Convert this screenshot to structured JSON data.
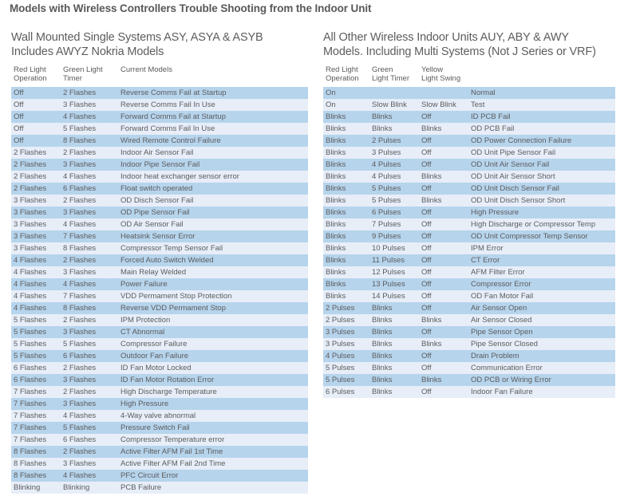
{
  "page": {
    "title": "Models with Wireless Controllers Trouble Shooting from the Indoor Unit",
    "stripe_dark": "#b6d4ec",
    "stripe_light": "#e7eef8",
    "text_color": "#5b5b5d"
  },
  "left": {
    "subtitle_line1": "Wall Mounted Single Systems ASY, ASYA & ASYB",
    "subtitle_line2": "Includes AWYZ Nokria Models",
    "headers": [
      "Red Light\nOperation",
      "Green Light\nTimer",
      "Current Models"
    ],
    "rows": [
      [
        "Off",
        "2 Flashes",
        "Reverse Comms Fail at Startup"
      ],
      [
        "Off",
        "3 Flashes",
        "Reverse Comms Fail In Use"
      ],
      [
        "Off",
        "4 Flashes",
        "Forward Comms Fail at Startup"
      ],
      [
        "Off",
        "5 Flashes",
        "Forward Comms Fail In Use"
      ],
      [
        "Off",
        "8 Flashes",
        "Wired Remote Control Failure"
      ],
      [
        "2 Flashes",
        "2 Flashes",
        "Indoor Air Sensor Fail"
      ],
      [
        "2 Flashes",
        "3 Flashes",
        "Indoor Pipe Sensor Fail"
      ],
      [
        "2 Flashes",
        "4 Flashes",
        "Indoor heat exchanger sensor error"
      ],
      [
        "2 Flashes",
        "6 Flashes",
        "Float switch operated"
      ],
      [
        "3 Flashes",
        "2 Flashes",
        "OD Disch Sensor Fail"
      ],
      [
        "3 Flashes",
        "3 Flashes",
        "OD Pipe Sensor Fail"
      ],
      [
        "3 Flashes",
        "4 Flashes",
        "OD Air Sensor Fail"
      ],
      [
        "3 Flashes",
        "7 Flashes",
        "Heatsink Sensor Error"
      ],
      [
        "3 Flashes",
        "8 Flashes",
        "Compressor Temp Sensor Fail"
      ],
      [
        "4 Flashes",
        "2 Flashes",
        "Forced Auto Switch Welded"
      ],
      [
        "4 Flashes",
        "3 Flashes",
        "Main Relay Welded"
      ],
      [
        "4 Flashes",
        "4 Flashes",
        "Power Failure"
      ],
      [
        "4 Flashes",
        "7 Flashes",
        "VDD Permament Stop Protection"
      ],
      [
        "4 Flashes",
        "8 Flashes",
        "Reverse VDD Permament Stop"
      ],
      [
        "5 Flashes",
        "2 Flashes",
        "IPM Protection"
      ],
      [
        "5 Flashes",
        "3 Flashes",
        "CT Abnormal"
      ],
      [
        "5 Flashes",
        "5 Flashes",
        "Compressor Failure"
      ],
      [
        "5 Flashes",
        "6 Flashes",
        "Outdoor Fan Failure"
      ],
      [
        "6 Flashes",
        "2 Flashes",
        "ID Fan Motor Locked"
      ],
      [
        "6 Flashes",
        "3 Flashes",
        "ID Fan Motor Rotation Error"
      ],
      [
        "7 Flashes",
        "2 Flashes",
        "High Discharge Temperature"
      ],
      [
        "7 Flashes",
        "3 Flashes",
        "High Pressure"
      ],
      [
        "7 Flashes",
        "4 Flashes",
        "4-Way valve abnormal"
      ],
      [
        "7 Flashes",
        "5 Flashes",
        "Pressure Switch Fail"
      ],
      [
        "7 Flashes",
        "6 Flashes",
        "Compressor Temperature error"
      ],
      [
        "8 Flashes",
        "2 Flashes",
        "Active Filter AFM Fail 1st Time"
      ],
      [
        "8 Flashes",
        "3 Flashes",
        "Active Filter AFM Fail 2nd Time"
      ],
      [
        "8 Flashes",
        "4 Flashes",
        "PFC Circuit Error"
      ],
      [
        "Blinking",
        "Blinking",
        "PCB Failure"
      ]
    ]
  },
  "right": {
    "subtitle_line1": "All Other Wireless Indoor Units AUY, ABY & AWY",
    "subtitle_line2": "Models. Including Multi Systems (Not J Series or VRF)",
    "headers": [
      "Red Light\nOperation",
      "Green\nLight Timer",
      "Yellow\nLight Swing",
      ""
    ],
    "rows": [
      [
        "On",
        "",
        "",
        "Normal"
      ],
      [
        "On",
        "Slow Blink",
        "Slow Blink",
        "Test"
      ],
      [
        "Blinks",
        "Blinks",
        "Off",
        "ID PCB Fail"
      ],
      [
        "Blinks",
        "Blinks",
        "Blinks",
        "OD PCB Fail"
      ],
      [
        "Blinks",
        "2 Pulses",
        "Off",
        "OD Power Connection Failure"
      ],
      [
        "Blinks",
        "3 Pulses",
        "Off",
        "OD Unit Pipe Sensor Fail"
      ],
      [
        "Blinks",
        "4 Pulses",
        "Off",
        "OD Unit Air Sensor Fail"
      ],
      [
        "Blinks",
        "4 Pulses",
        "Blinks",
        "OD Unit Air Sensor Short"
      ],
      [
        "Blinks",
        "5 Pulses",
        "Off",
        "OD Unit Disch Sensor Fail"
      ],
      [
        "Blinks",
        "5 Pulses",
        "Blinks",
        "OD Unit Disch Sensor Short"
      ],
      [
        "Blinks",
        "6 Pulses",
        "Off",
        "High Pressure"
      ],
      [
        "Blinks",
        "7 Pulses",
        "Off",
        "High Discharge or Compressor Temp"
      ],
      [
        "Blinks",
        "9 Pulses",
        "Off",
        "OD Unit Compressor Temp Sensor"
      ],
      [
        "Blinks",
        "10 Pulses",
        "Off",
        "IPM Error"
      ],
      [
        "Blinks",
        "11 Pulses",
        "Off",
        "CT Error"
      ],
      [
        "Blinks",
        "12 Pulses",
        "Off",
        "AFM Filter Error"
      ],
      [
        "Blinks",
        "13 Pulses",
        "Off",
        "Compressor Error"
      ],
      [
        "Blinks",
        "14 Pulses",
        "Off",
        "OD Fan Motor Fail"
      ],
      [
        "2 Pulses",
        "Blinks",
        "Off",
        "Air Sensor Open"
      ],
      [
        "2 Pulses",
        "Blinks",
        "Blinks",
        "Air Sensor Closed"
      ],
      [
        "3 Pulses",
        "Blinks",
        "Off",
        "Pipe Sensor Open"
      ],
      [
        "3 Pulses",
        "Blinks",
        "Blinks",
        "Pipe Sensor Closed"
      ],
      [
        "4 Pulses",
        "Blinks",
        "Off",
        "Drain Problem"
      ],
      [
        "5 Pulses",
        "Blinks",
        "Off",
        "Communication Error"
      ],
      [
        "5 Pulses",
        "Blinks",
        "Blinks",
        "OD PCB or Wiring Error"
      ],
      [
        "6 Pulses",
        "Blinks",
        "Off",
        "Indoor Fan Failure"
      ]
    ]
  }
}
